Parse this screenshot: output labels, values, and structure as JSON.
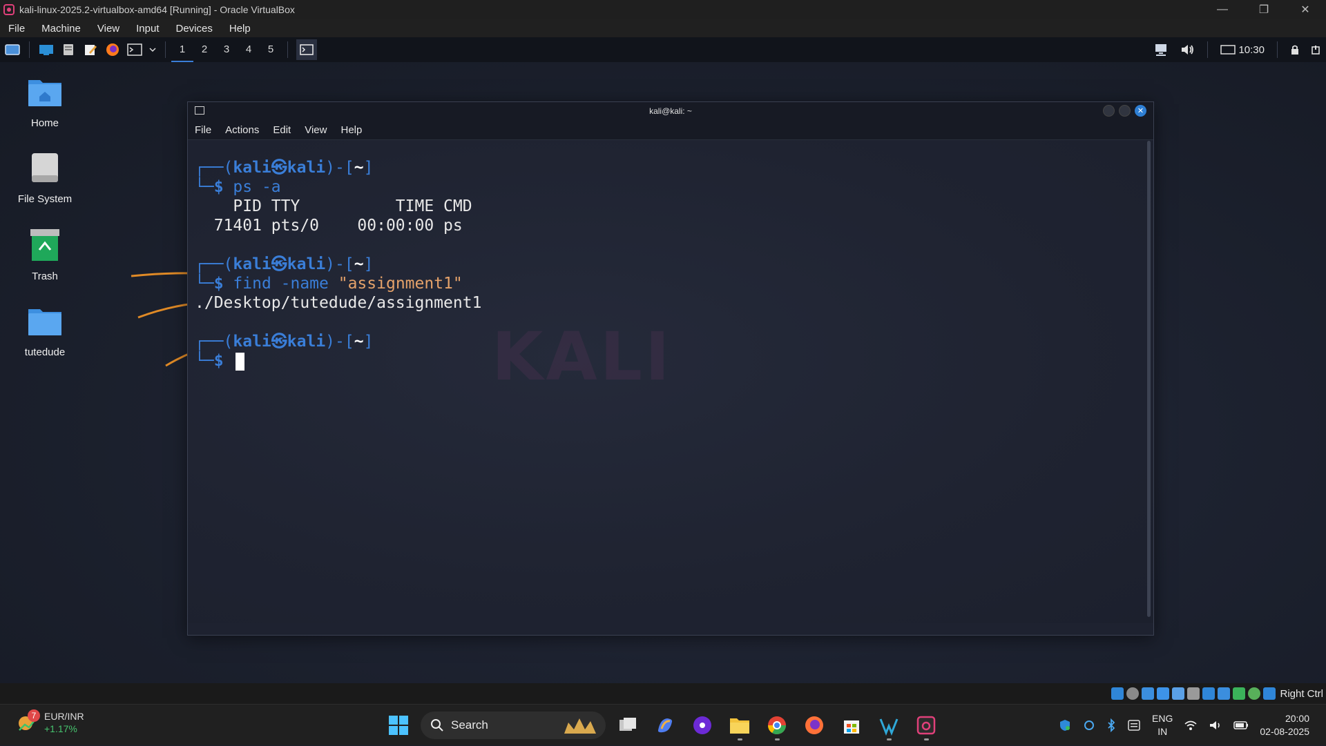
{
  "host": {
    "title": "kali-linux-2025.2-virtualbox-amd64 [Running] - Oracle VirtualBox",
    "menu": [
      "File",
      "Machine",
      "View",
      "Input",
      "Devices",
      "Help"
    ]
  },
  "kali_panel": {
    "workspaces": [
      "1",
      "2",
      "3",
      "4",
      "5"
    ],
    "active_workspace": "1",
    "time": "10:30"
  },
  "desktop_icons": [
    {
      "label": "Home"
    },
    {
      "label": "File System"
    },
    {
      "label": "Trash"
    },
    {
      "label": "tutedude"
    }
  ],
  "terminal": {
    "title": "kali@kali: ~",
    "menu": [
      "File",
      "Actions",
      "Edit",
      "View",
      "Help"
    ],
    "prompt_user": "kali",
    "prompt_host": "kali",
    "prompt_dir": "~",
    "commands": {
      "c1": "ps -a",
      "c2_cmd": "find -name ",
      "c2_arg": "\"assignment1\""
    },
    "output": {
      "ps_header": "    PID TTY          TIME CMD",
      "ps_row": "  71401 pts/0    00:00:00 ps",
      "find_result": "./Desktop/tutedude/assignment1"
    },
    "watermark": "KALI"
  },
  "vb_status": {
    "host_key": "Right Ctrl"
  },
  "taskbar": {
    "weather_badge": "7",
    "ticker": "EUR/INR",
    "ticker_change": "+1.17%",
    "search_label": "Search",
    "lang_line1": "ENG",
    "lang_line2": "IN",
    "time": "20:00",
    "date": "02-08-2025"
  }
}
